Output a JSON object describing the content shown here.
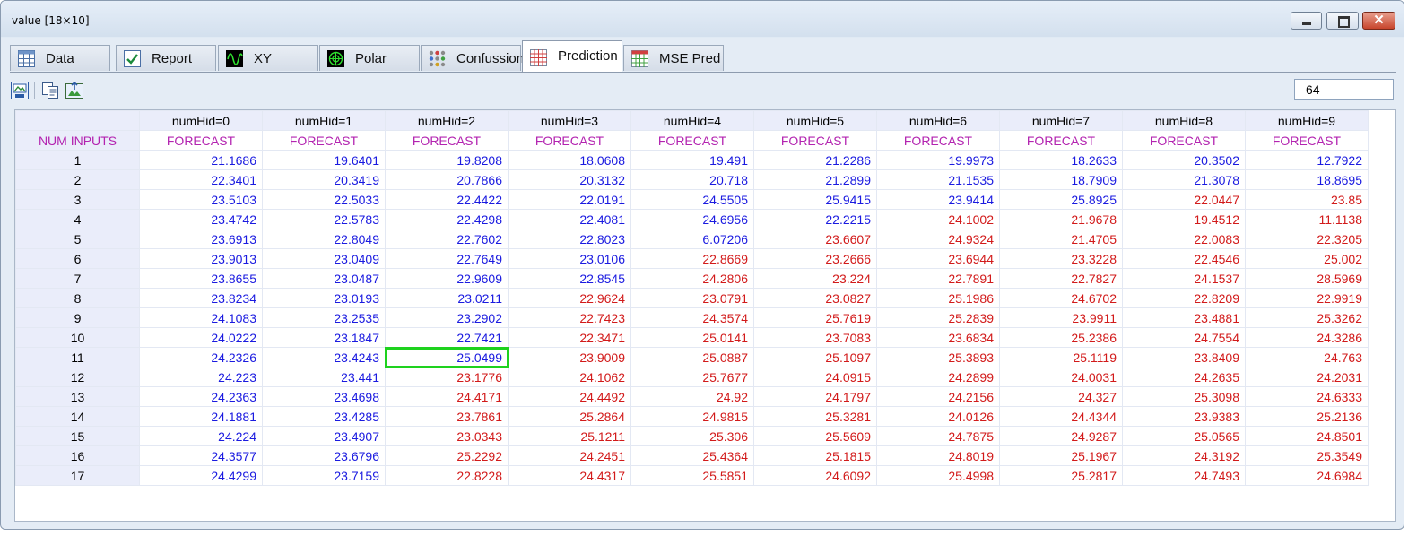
{
  "window": {
    "title": "value [18×10]"
  },
  "tabs": [
    {
      "label": "Data",
      "icon": "table-icon",
      "active": false
    },
    {
      "label": "Report",
      "icon": "checkmark-icon",
      "active": false
    },
    {
      "label": "XY",
      "icon": "sine-wave-icon",
      "active": false
    },
    {
      "label": "Polar",
      "icon": "polar-plot-icon",
      "active": false
    },
    {
      "label": "Confussion",
      "icon": "dot-matrix-icon",
      "active": false
    },
    {
      "label": "Prediction",
      "icon": "grid-icon",
      "active": true
    },
    {
      "label": "MSE Pred",
      "icon": "mse-grid-icon",
      "active": false
    }
  ],
  "toolbar": {
    "value": "64"
  },
  "grid": {
    "col_headers": [
      "numHid=0",
      "numHid=1",
      "numHid=2",
      "numHid=3",
      "numHid=4",
      "numHid=5",
      "numHid=6",
      "numHid=7",
      "numHid=8",
      "numHid=9"
    ],
    "row_label_header": "NUM INPUTS",
    "sub_header": "FORECAST",
    "colors": {
      "blue": "#1a1ae0",
      "red": "#d21a1a",
      "selected": "#1ed21e"
    },
    "selected_cell": {
      "row": 10,
      "col": 2
    },
    "rows": [
      {
        "label": "1",
        "values": [
          "21.1686",
          "19.6401",
          "19.8208",
          "18.0608",
          "19.491",
          "21.2286",
          "19.9973",
          "18.2633",
          "20.3502",
          "12.7922"
        ],
        "colors": [
          "blue",
          "blue",
          "blue",
          "blue",
          "blue",
          "blue",
          "blue",
          "blue",
          "blue",
          "blue"
        ]
      },
      {
        "label": "2",
        "values": [
          "22.3401",
          "20.3419",
          "20.7866",
          "20.3132",
          "20.718",
          "21.2899",
          "21.1535",
          "18.7909",
          "21.3078",
          "18.8695"
        ],
        "colors": [
          "blue",
          "blue",
          "blue",
          "blue",
          "blue",
          "blue",
          "blue",
          "blue",
          "blue",
          "blue"
        ]
      },
      {
        "label": "3",
        "values": [
          "23.5103",
          "22.5033",
          "22.4422",
          "22.0191",
          "24.5505",
          "25.9415",
          "23.9414",
          "25.8925",
          "22.0447",
          "23.85"
        ],
        "colors": [
          "blue",
          "blue",
          "blue",
          "blue",
          "blue",
          "blue",
          "blue",
          "blue",
          "red",
          "red"
        ]
      },
      {
        "label": "4",
        "values": [
          "23.4742",
          "22.5783",
          "22.4298",
          "22.4081",
          "24.6956",
          "22.2215",
          "24.1002",
          "21.9678",
          "19.4512",
          "11.1138"
        ],
        "colors": [
          "blue",
          "blue",
          "blue",
          "blue",
          "blue",
          "blue",
          "red",
          "red",
          "red",
          "red"
        ]
      },
      {
        "label": "5",
        "values": [
          "23.6913",
          "22.8049",
          "22.7602",
          "22.8023",
          "6.07206",
          "23.6607",
          "24.9324",
          "21.4705",
          "22.0083",
          "22.3205"
        ],
        "colors": [
          "blue",
          "blue",
          "blue",
          "blue",
          "blue",
          "red",
          "red",
          "red",
          "red",
          "red"
        ]
      },
      {
        "label": "6",
        "values": [
          "23.9013",
          "23.0409",
          "22.7649",
          "23.0106",
          "22.8669",
          "23.2666",
          "23.6944",
          "23.3228",
          "22.4546",
          "25.002"
        ],
        "colors": [
          "blue",
          "blue",
          "blue",
          "blue",
          "red",
          "red",
          "red",
          "red",
          "red",
          "red"
        ]
      },
      {
        "label": "7",
        "values": [
          "23.8655",
          "23.0487",
          "22.9609",
          "22.8545",
          "24.2806",
          "23.224",
          "22.7891",
          "22.7827",
          "24.1537",
          "28.5969"
        ],
        "colors": [
          "blue",
          "blue",
          "blue",
          "blue",
          "red",
          "red",
          "red",
          "red",
          "red",
          "red"
        ]
      },
      {
        "label": "8",
        "values": [
          "23.8234",
          "23.0193",
          "23.0211",
          "22.9624",
          "23.0791",
          "23.0827",
          "25.1986",
          "24.6702",
          "22.8209",
          "22.9919"
        ],
        "colors": [
          "blue",
          "blue",
          "blue",
          "red",
          "red",
          "red",
          "red",
          "red",
          "red",
          "red"
        ]
      },
      {
        "label": "9",
        "values": [
          "24.1083",
          "23.2535",
          "23.2902",
          "22.7423",
          "24.3574",
          "25.7619",
          "25.2839",
          "23.9911",
          "23.4881",
          "25.3262"
        ],
        "colors": [
          "blue",
          "blue",
          "blue",
          "red",
          "red",
          "red",
          "red",
          "red",
          "red",
          "red"
        ]
      },
      {
        "label": "10",
        "values": [
          "24.0222",
          "23.1847",
          "22.7421",
          "22.3471",
          "25.0141",
          "23.7083",
          "23.6834",
          "25.2386",
          "24.7554",
          "24.3286"
        ],
        "colors": [
          "blue",
          "blue",
          "blue",
          "red",
          "red",
          "red",
          "red",
          "red",
          "red",
          "red"
        ]
      },
      {
        "label": "11",
        "values": [
          "24.2326",
          "23.4243",
          "25.0499",
          "23.9009",
          "25.0887",
          "25.1097",
          "25.3893",
          "25.1119",
          "23.8409",
          "24.763"
        ],
        "colors": [
          "blue",
          "blue",
          "blue",
          "red",
          "red",
          "red",
          "red",
          "red",
          "red",
          "red"
        ]
      },
      {
        "label": "12",
        "values": [
          "24.223",
          "23.441",
          "23.1776",
          "24.1062",
          "25.7677",
          "24.0915",
          "24.2899",
          "24.0031",
          "24.2635",
          "24.2031"
        ],
        "colors": [
          "blue",
          "blue",
          "red",
          "red",
          "red",
          "red",
          "red",
          "red",
          "red",
          "red"
        ]
      },
      {
        "label": "13",
        "values": [
          "24.2363",
          "23.4698",
          "24.4171",
          "24.4492",
          "24.92",
          "24.1797",
          "24.2156",
          "24.327",
          "25.3098",
          "24.6333"
        ],
        "colors": [
          "blue",
          "blue",
          "red",
          "red",
          "red",
          "red",
          "red",
          "red",
          "red",
          "red"
        ]
      },
      {
        "label": "14",
        "values": [
          "24.1881",
          "23.4285",
          "23.7861",
          "25.2864",
          "24.9815",
          "25.3281",
          "24.0126",
          "24.4344",
          "23.9383",
          "25.2136"
        ],
        "colors": [
          "blue",
          "blue",
          "red",
          "red",
          "red",
          "red",
          "red",
          "red",
          "red",
          "red"
        ]
      },
      {
        "label": "15",
        "values": [
          "24.224",
          "23.4907",
          "23.0343",
          "25.1211",
          "25.306",
          "25.5609",
          "24.7875",
          "24.9287",
          "25.0565",
          "24.8501"
        ],
        "colors": [
          "blue",
          "blue",
          "red",
          "red",
          "red",
          "red",
          "red",
          "red",
          "red",
          "red"
        ]
      },
      {
        "label": "16",
        "values": [
          "24.3577",
          "23.6796",
          "25.2292",
          "24.2451",
          "25.4364",
          "25.1815",
          "24.8019",
          "25.1967",
          "24.3192",
          "25.3549"
        ],
        "colors": [
          "blue",
          "blue",
          "red",
          "red",
          "red",
          "red",
          "red",
          "red",
          "red",
          "red"
        ]
      },
      {
        "label": "17",
        "values": [
          "24.4299",
          "23.7159",
          "22.8228",
          "24.4317",
          "25.5851",
          "24.6092",
          "25.4998",
          "25.2817",
          "24.7493",
          "24.6984"
        ],
        "colors": [
          "blue",
          "blue",
          "red",
          "red",
          "red",
          "red",
          "red",
          "red",
          "red",
          "red"
        ]
      }
    ]
  }
}
